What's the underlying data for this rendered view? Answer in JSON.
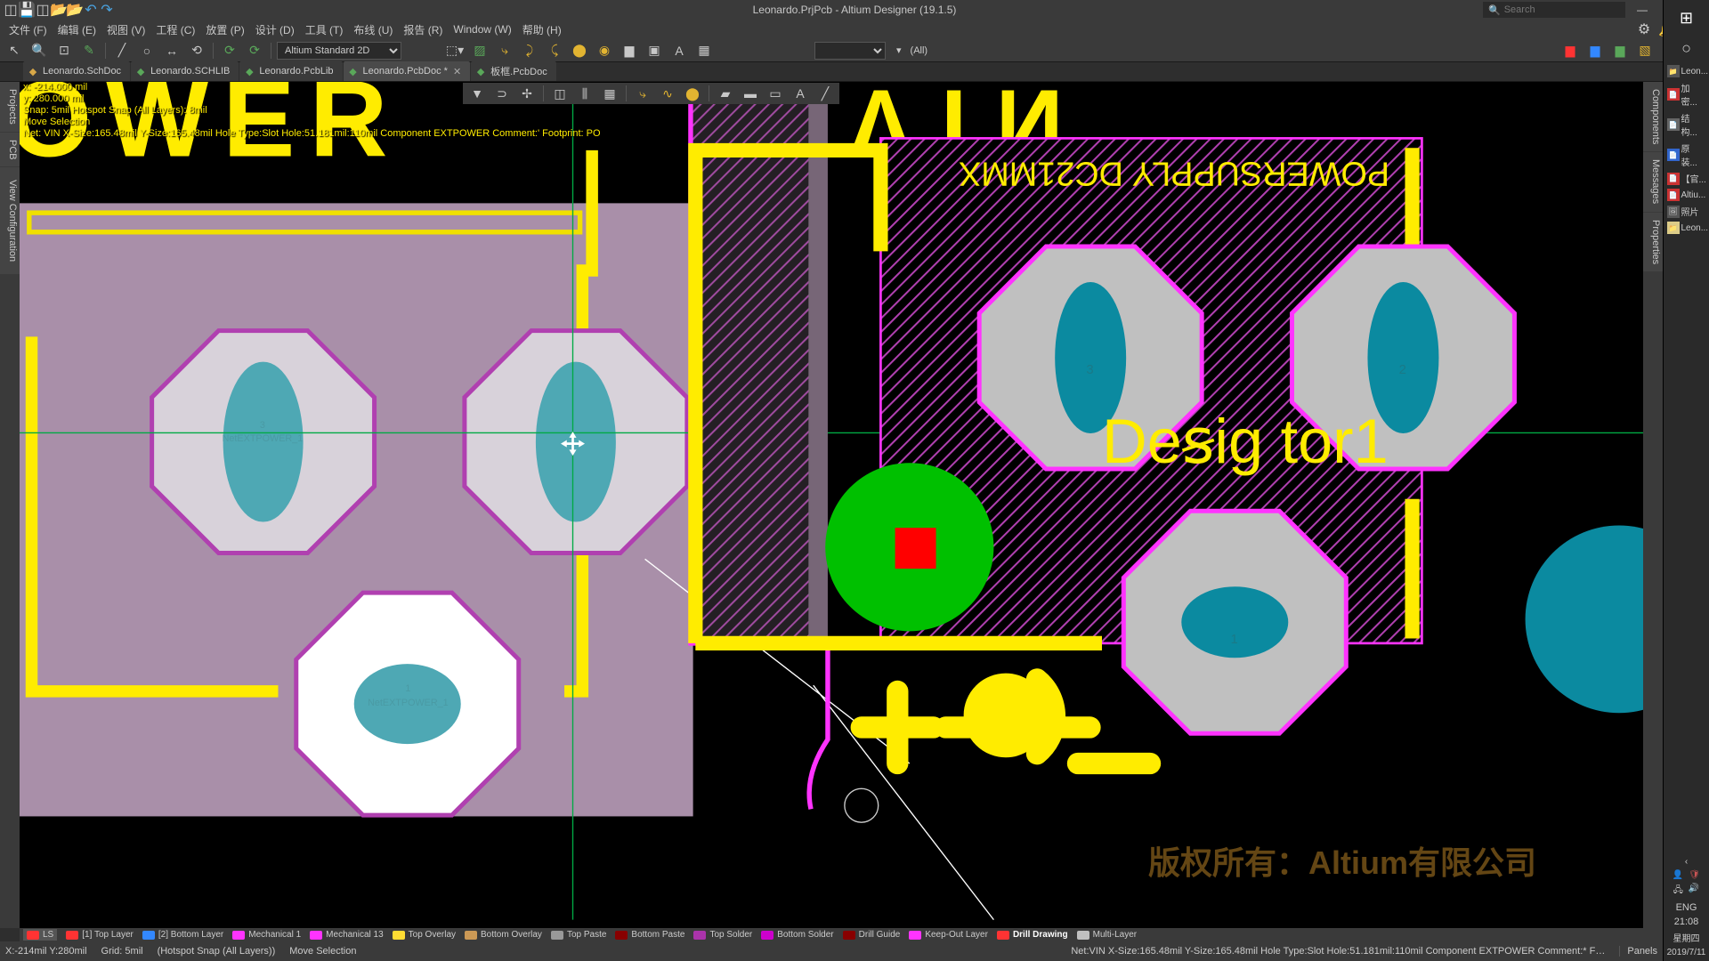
{
  "title": "Leonardo.PrjPcb - Altium Designer (19.1.5)",
  "search_placeholder": "Search",
  "menus": [
    "文件 (F)",
    "编辑 (E)",
    "视图 (V)",
    "工程 (C)",
    "放置 (P)",
    "设计 (D)",
    "工具 (T)",
    "布线 (U)",
    "报告 (R)",
    "Window (W)",
    "帮助 (H)"
  ],
  "mode_select": "Altium Standard 2D",
  "filter_label": "(All)",
  "tabs": [
    {
      "label": "Leonardo.SchDoc",
      "active": false,
      "color": "#d8a848"
    },
    {
      "label": "Leonardo.SCHLIB",
      "active": false,
      "color": "#5aa85a"
    },
    {
      "label": "Leonardo.PcbLib",
      "active": false,
      "color": "#5aa85a"
    },
    {
      "label": "Leonardo.PcbDoc *",
      "active": true,
      "color": "#5aa85a"
    },
    {
      "label": "板框.PcbDoc",
      "active": false,
      "color": "#5aa85a"
    }
  ],
  "left_vtab": [
    "Projects",
    "PCB",
    "View Configuration"
  ],
  "right_vtab": [
    "Components",
    "Messages",
    "Properties"
  ],
  "hud": {
    "x": "x: -214.000 mil",
    "y": "y:  280.000 mil",
    "snap": "Snap: 5mil Hotspot Snap (All Layers): 8mil",
    "move": "Move Selection",
    "net": "Net: VIN X-Size:165.48mil Y-Size:165.48mil Hole Type:Slot Hole:51.181mil:110mil   Component EXTPOWER Comment:' Footprint: PO"
  },
  "layers": [
    {
      "name": "LS",
      "color": "#ff3333",
      "active_bg": "#555"
    },
    {
      "name": "[1] Top Layer",
      "color": "#ff3333"
    },
    {
      "name": "[2] Bottom Layer",
      "color": "#3388ff"
    },
    {
      "name": "Mechanical 1",
      "color": "#ff33ff"
    },
    {
      "name": "Mechanical 13",
      "color": "#ff33ff"
    },
    {
      "name": "Top Overlay",
      "color": "#ffdd33"
    },
    {
      "name": "Bottom Overlay",
      "color": "#cc9955"
    },
    {
      "name": "Top Paste",
      "color": "#999999"
    },
    {
      "name": "Bottom Paste",
      "color": "#880000"
    },
    {
      "name": "Top Solder",
      "color": "#aa33aa"
    },
    {
      "name": "Bottom Solder",
      "color": "#cc00cc"
    },
    {
      "name": "Drill Guide",
      "color": "#880000"
    },
    {
      "name": "Keep-Out Layer",
      "color": "#ff33ff"
    },
    {
      "name": "Drill Drawing",
      "color": "#ff3333",
      "bold": true
    },
    {
      "name": "Multi-Layer",
      "color": "#c0c0c0"
    }
  ],
  "status": {
    "coord": "X:-214mil Y:280mil",
    "grid": "Grid: 5mil",
    "snap": "(Hotspot Snap (All Layers))",
    "mode": "Move Selection",
    "net": "Net:VIN X-Size:165.48mil Y-Size:165.48mil Hole Type:Slot Hole:51.181mil:110mil  Component EXTPOWER Comment:* Footprint: POWERSUI",
    "panels": "Panels"
  },
  "pcb_text": {
    "top_silkscreen": "POWERSUPPLY DC21MMX",
    "designator": "Deꞩig   tor1",
    "ghost_text": "OWER",
    "vin_text": "VIN",
    "pad3": "3",
    "pad2": "2",
    "pad1": "1",
    "ghost_pad3_label": "3",
    "ghost_pad3_net": "NetEXTPOWER_1",
    "ghost_pad1_label": "1",
    "ghost_pad1_net": "NetEXTPOWER_1"
  },
  "win_links": [
    "Leon...",
    "加密...",
    "结构...",
    "原装...",
    "【官...",
    "Altiu...",
    "照片",
    "Leon..."
  ],
  "win_tray": {
    "ime": "ENG",
    "time": "21:08",
    "day": "星期四",
    "date": "2019/7/11"
  },
  "watermark": "版权所有：Altium有限公司"
}
